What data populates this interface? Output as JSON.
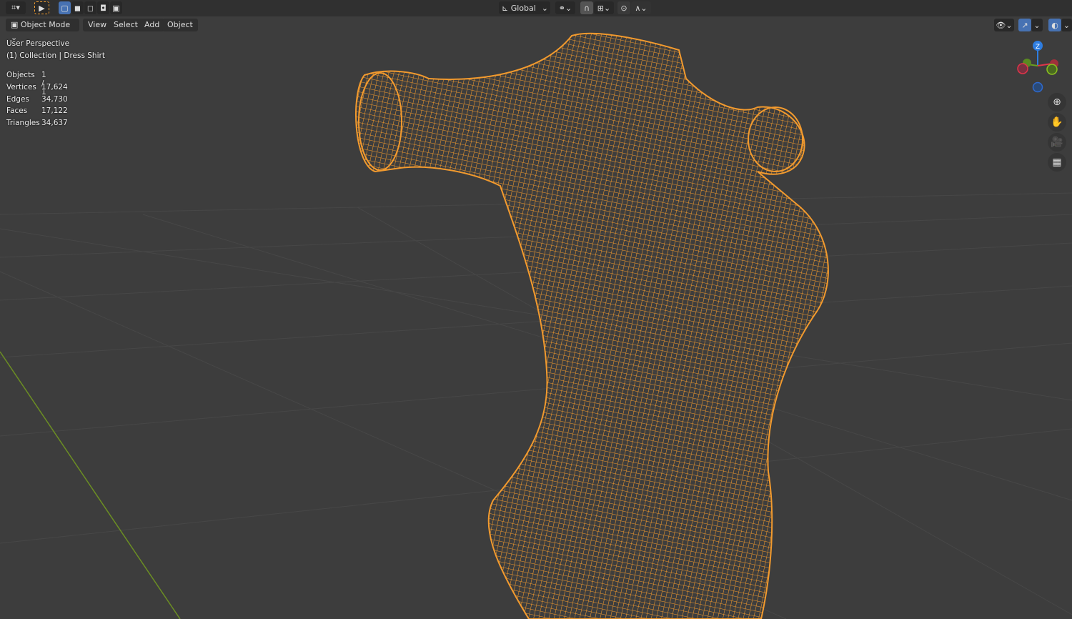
{
  "toolbar": {
    "editor_type_icon": "viewport-icon",
    "select_tool_icon": "cursor-icon",
    "transform_orientation": "Global",
    "colors": {
      "accent": "#4772b3",
      "selection": "#f5a030"
    }
  },
  "header": {
    "mode": "Object Mode",
    "menus": [
      "View",
      "Select",
      "Add",
      "Object"
    ]
  },
  "overlay": {
    "view_name": "User Perspective",
    "collection": "(1) Collection | Dress Shirt"
  },
  "stats": [
    {
      "label": "Objects",
      "value": "1 / 1"
    },
    {
      "label": "Vertices",
      "value": "17,624"
    },
    {
      "label": "Edges",
      "value": "34,730"
    },
    {
      "label": "Faces",
      "value": "17,122"
    },
    {
      "label": "Triangles",
      "value": "34,637"
    }
  ],
  "gizmo": {
    "z": "Z",
    "x": "X",
    "y": "Y"
  }
}
